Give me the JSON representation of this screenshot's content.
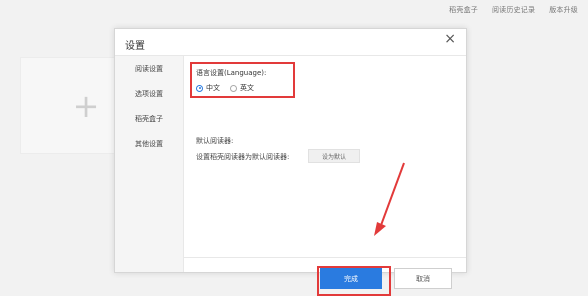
{
  "topnav": {
    "items": [
      "稻壳盒子",
      "阅读历史记录",
      "版本升级"
    ]
  },
  "dialog": {
    "title": "设置",
    "close_symbol": "×"
  },
  "sidebar": {
    "items": [
      {
        "label": "阅读设置"
      },
      {
        "label": "选项设置"
      },
      {
        "label": "稻壳盒子"
      },
      {
        "label": "其他设置"
      }
    ]
  },
  "language": {
    "label": "语言设置(Language):",
    "options": [
      {
        "label": "中文",
        "checked": true
      },
      {
        "label": "英文",
        "checked": false
      }
    ]
  },
  "default_reader": {
    "label": "默认阅读器:",
    "desc": "设置稻壳阅读器为默认阅读器:",
    "button": "设为默认"
  },
  "footer": {
    "done": "完成",
    "cancel": "取消"
  },
  "background": {
    "plus": "+"
  },
  "colors": {
    "accent": "#2a7be0",
    "highlight": "#e23a3a"
  }
}
